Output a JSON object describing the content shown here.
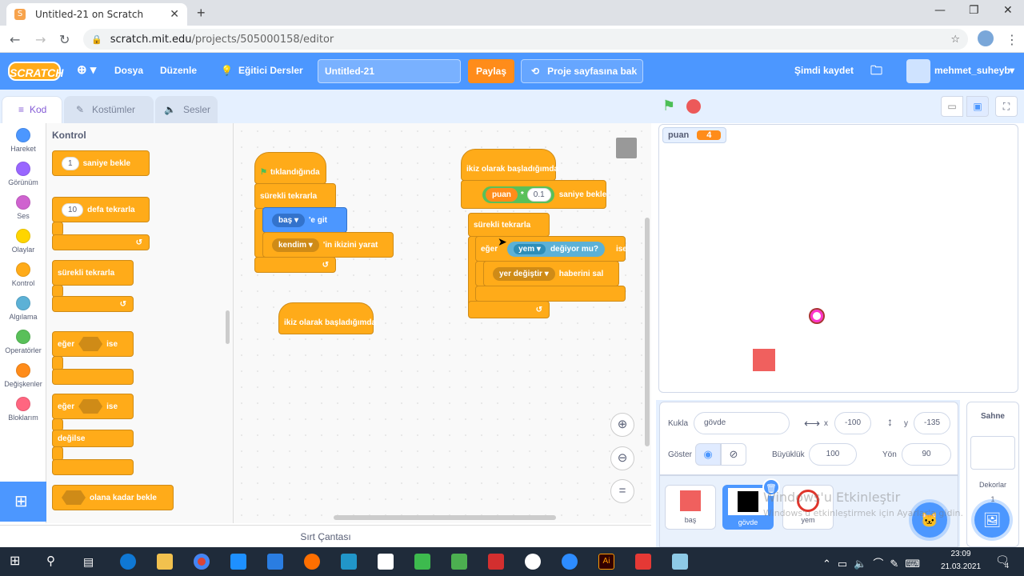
{
  "browser": {
    "tab_title": "Untitled-21 on Scratch",
    "url_host": "scratch.mit.edu",
    "url_path": "/projects/505000158/editor"
  },
  "menu": {
    "logo": "SCRATCH",
    "file": "Dosya",
    "edit": "Düzenle",
    "tutorials": "Eğitici Dersler",
    "project_title": "Untitled-21",
    "share": "Paylaş",
    "see_project_page": "Proje sayfasına bak",
    "save_now": "Şimdi kaydet",
    "username": "mehmet_suheyb"
  },
  "editor_tabs": {
    "code": "Kod",
    "costumes": "Kostümler",
    "sounds": "Sesler"
  },
  "categories": [
    {
      "label": "Hareket",
      "color": "#4c97ff"
    },
    {
      "label": "Görünüm",
      "color": "#9966ff"
    },
    {
      "label": "Ses",
      "color": "#cf63cf"
    },
    {
      "label": "Olaylar",
      "color": "#ffd500"
    },
    {
      "label": "Kontrol",
      "color": "#ffab19"
    },
    {
      "label": "Algılama",
      "color": "#5cb1d6"
    },
    {
      "label": "Operatörler",
      "color": "#59c059"
    },
    {
      "label": "Değişkenler",
      "color": "#ff8c1a"
    },
    {
      "label": "Bloklarım",
      "color": "#ff6680"
    }
  ],
  "palette": {
    "heading": "Kontrol",
    "wait_num": "1",
    "wait_label": "saniye bekle",
    "repeat_num": "10",
    "repeat_label": "defa tekrarla",
    "forever": "sürekli tekrarla",
    "if": "eğer",
    "then": "ise",
    "if2": "eğer",
    "then2": "ise",
    "else": "değilse",
    "wait_until": "olana kadar bekle"
  },
  "script1": {
    "hat": "tıklandığında",
    "forever": "sürekli tekrarla",
    "goto_dd": "baş",
    "goto_label": "'e git",
    "clone_dd": "kendim",
    "clone_label": "'in ikizini yarat"
  },
  "script2": {
    "hat": "ikiz olarak başladığımda"
  },
  "script3": {
    "hat": "ikiz olarak başladığımda",
    "wait_var": "puan",
    "wait_op": "*",
    "wait_num": "0.1",
    "wait_label": "saniye bekle",
    "forever": "sürekli tekrarla",
    "if": "eğer",
    "touch_dd": "yem",
    "touch_label": "değiyor mu?",
    "then": "ise",
    "broadcast_dd": "yer değiştir",
    "broadcast_label": "haberini sal"
  },
  "backpack": "Sırt Çantası",
  "monitor": {
    "name": "puan",
    "value": "4"
  },
  "sprite_info": {
    "sprite_label": "Kukla",
    "sprite_name": "gövde",
    "x_label": "x",
    "x": "-100",
    "y_label": "y",
    "y": "-135",
    "show_label": "Göster",
    "size_label": "Büyüklük",
    "size": "100",
    "dir_label": "Yön",
    "direction": "90"
  },
  "sprites": [
    {
      "name": "baş",
      "color": "#f0605e"
    },
    {
      "name": "gövde",
      "color": "#000000"
    },
    {
      "name": "yem",
      "color": "#e0352c"
    }
  ],
  "scene": {
    "title": "Sahne",
    "backdrops_label": "Dekorlar",
    "backdrops_count": "1"
  },
  "watermark": {
    "line1": "Windows'u Etkinleştir",
    "line2": "Windows'u etkinleştirmek için Ayarlar'a gidin."
  },
  "taskbar": {
    "time": "23:09",
    "date": "21.03.2021",
    "notif": "4"
  }
}
